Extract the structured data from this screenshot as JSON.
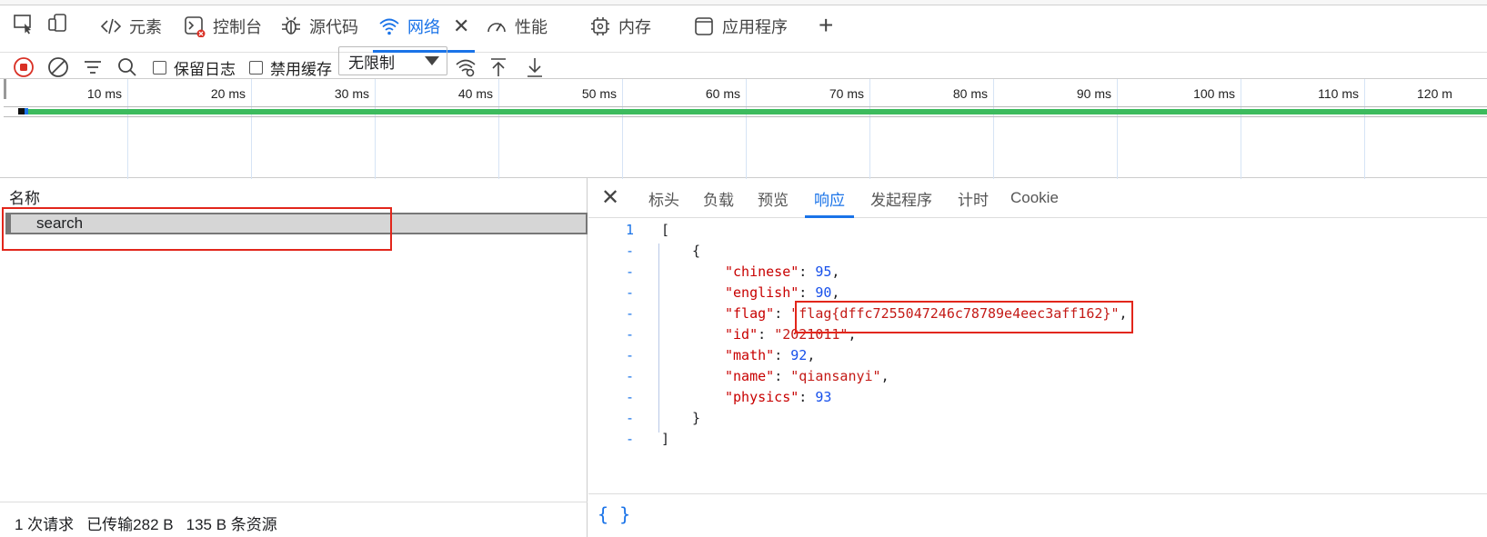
{
  "tabs": [
    {
      "label": "元素",
      "icon": "code-icon"
    },
    {
      "label": "控制台",
      "icon": "console-icon"
    },
    {
      "label": "源代码",
      "icon": "bug-icon"
    },
    {
      "label": "网络",
      "icon": "wifi-icon"
    },
    {
      "label": "性能",
      "icon": "gauge-icon"
    },
    {
      "label": "内存",
      "icon": "chip-icon"
    },
    {
      "label": "应用程序",
      "icon": "window-icon"
    }
  ],
  "toolbar": {
    "preserve_log": "保留日志",
    "disable_cache": "禁用缓存",
    "throttle_value": "无限制"
  },
  "timeline": {
    "ticks": [
      "10 ms",
      "20 ms",
      "30 ms",
      "40 ms",
      "50 ms",
      "60 ms",
      "70 ms",
      "80 ms",
      "90 ms",
      "100 ms",
      "110 ms",
      "120 m"
    ]
  },
  "requests": {
    "column_name": "名称",
    "rows": [
      "search"
    ]
  },
  "status": {
    "requests": "1 次请求",
    "transferred": "已传输282 B",
    "resources": "135 B 条资源"
  },
  "detail_tabs": [
    "标头",
    "负载",
    "预览",
    "响应",
    "发起程序",
    "计时",
    "Cookie"
  ],
  "response": {
    "line1_no": "1",
    "fold": "-",
    "open_bracket": "[",
    "open_brace": "{",
    "fields": [
      {
        "key": "\"chinese\"",
        "value": "95",
        "type": "num",
        "comma": ","
      },
      {
        "key": "\"english\"",
        "value": "90",
        "type": "num",
        "comma": ","
      },
      {
        "key": "\"flag\"",
        "value": "\"flag{dffc7255047246c78789e4eec3aff162}\"",
        "type": "str",
        "comma": ","
      },
      {
        "key": "\"id\"",
        "value": "\"2021011\"",
        "type": "str",
        "comma": ","
      },
      {
        "key": "\"math\"",
        "value": "92",
        "type": "num",
        "comma": ","
      },
      {
        "key": "\"name\"",
        "value": "\"qiansanyi\"",
        "type": "str",
        "comma": ","
      },
      {
        "key": "\"physics\"",
        "value": "93",
        "type": "num",
        "comma": ""
      }
    ],
    "close_brace": "}",
    "close_bracket": "]",
    "status_glyph": "{ }"
  },
  "colors": {
    "accent": "#1a73e8",
    "highlight": "#e2261b",
    "timeline": "#3dbb5d"
  }
}
